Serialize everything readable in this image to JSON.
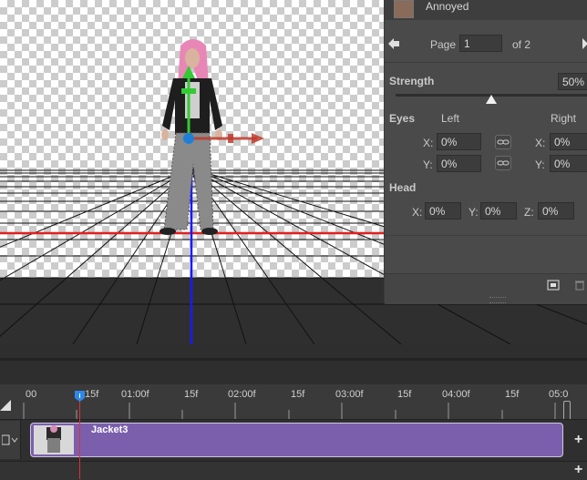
{
  "expression_panel": {
    "preset_name": "Annoyed",
    "page_label": "Page",
    "page_value": "1",
    "page_total": "of 2",
    "strength_label": "Strength",
    "strength_value": "50%",
    "strength_fraction": 0.5,
    "eyes_label": "Eyes",
    "eyes_left_label": "Left",
    "eyes_right_label": "Right",
    "eyes_left_x_label": "X:",
    "eyes_left_x": "0%",
    "eyes_left_y_label": "Y:",
    "eyes_left_y": "0%",
    "eyes_right_x_label": "X:",
    "eyes_right_x": "0%",
    "eyes_right_y_label": "Y:",
    "eyes_right_y": "0%",
    "head_label": "Head",
    "head_x_label": "X:",
    "head_x": "0%",
    "head_y_label": "Y:",
    "head_y": "0%",
    "head_z_label": "Z:",
    "head_z": "0%"
  },
  "timeline": {
    "ticks": [
      "00",
      "15f",
      "01:00f",
      "15f",
      "02:00f",
      "15f",
      "03:00f",
      "15f",
      "04:00f",
      "15f",
      "05:0"
    ],
    "clip_name": "Jacket3",
    "clip_color": "#7b5fad"
  },
  "colors": {
    "panel_bg": "#4a4a4a",
    "x_axis": "#e02020",
    "z_axis": "#1a1aff",
    "clip": "#7b5fad"
  }
}
